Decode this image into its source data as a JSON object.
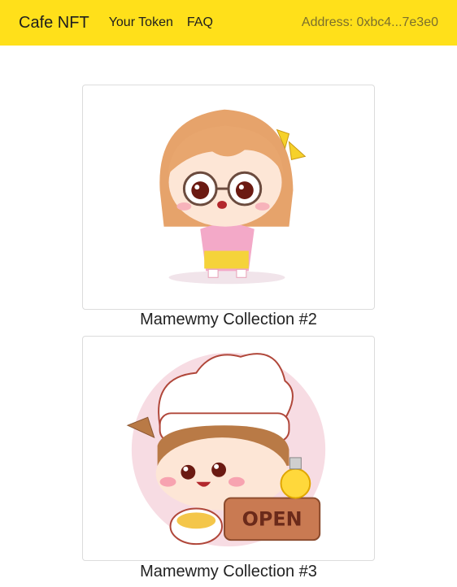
{
  "nav": {
    "brand": "Cafe NFT",
    "links": [
      "Your Token",
      "FAQ"
    ],
    "address": "Address: 0xbc4...7e3e0"
  },
  "colors": {
    "navbar": "#ffe01a",
    "address_text": "#7b6f2c"
  },
  "collection": [
    {
      "title": "Mamewmy Collection #2",
      "image": "chibi-girl-praying-illustration"
    },
    {
      "title": "Mamewmy Collection #3",
      "image": "chibi-chef-girl-open-sign-illustration"
    }
  ]
}
